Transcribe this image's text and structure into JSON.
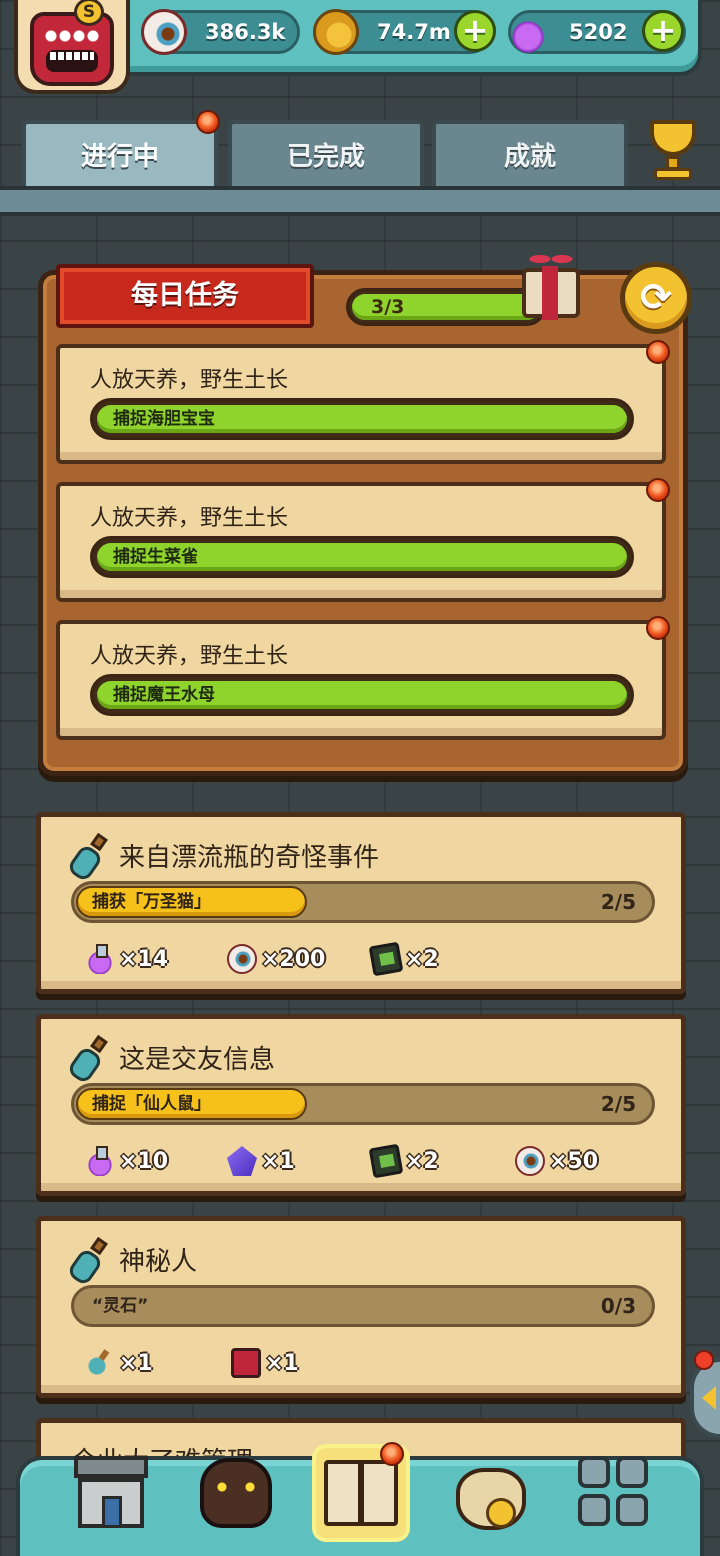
{
  "resources": [
    {
      "icon": "eyeball-icon",
      "value": "386.3k"
    },
    {
      "icon": "coin-icon",
      "value": "74.7m"
    },
    {
      "icon": "potion-icon",
      "value": "5202"
    }
  ],
  "avatar": {
    "badge": "S",
    "icon": "monster-avatar-icon"
  },
  "plus_symbol": "+",
  "tabs": [
    {
      "label": "进行中",
      "active": true,
      "has_dot": true
    },
    {
      "label": "已完成",
      "active": false,
      "has_dot": false
    },
    {
      "label": "成就",
      "active": false,
      "has_dot": false
    }
  ],
  "daily": {
    "title": "每日任务",
    "progress_text": "3/3",
    "progress": 1.0,
    "refresh_symbol": "⟳",
    "quests": [
      {
        "title": "人放天养，野生土长",
        "task": "捕捉海胆宝宝",
        "progress": 1.0
      },
      {
        "title": "人放天养，野生土长",
        "task": "捕捉生菜雀",
        "progress": 1.0
      },
      {
        "title": "人放天养，野生土长",
        "task": "捕捉魔王水母",
        "progress": 1.0
      }
    ]
  },
  "events": [
    {
      "title": "来自漂流瓶的奇怪事件",
      "task": "捕获「万圣猫」",
      "count": "2/5",
      "progress": 0.4,
      "rewards": [
        {
          "icon": "potion-icon",
          "qty": "×14"
        },
        {
          "icon": "eyeball-icon",
          "qty": "×200"
        },
        {
          "icon": "card-icon",
          "qty": "×2"
        }
      ]
    },
    {
      "title": "这是交友信息",
      "task": "捕捉「仙人鼠」",
      "count": "2/5",
      "progress": 0.4,
      "rewards": [
        {
          "icon": "potion-icon",
          "qty": "×10"
        },
        {
          "icon": "crystal-icon",
          "qty": "×1"
        },
        {
          "icon": "card-icon",
          "qty": "×2"
        },
        {
          "icon": "eyeball-icon",
          "qty": "×50"
        }
      ]
    },
    {
      "title": "神秘人",
      "task": "“灵石”",
      "count": "0/3",
      "progress": 0.0,
      "rewards": [
        {
          "icon": "bottle-icon",
          "qty": "×1"
        },
        {
          "icon": "jar-icon",
          "qty": "×1"
        }
      ]
    },
    {
      "title": "企业大了难管理",
      "task": "",
      "count": "",
      "progress": 0.0,
      "rewards": []
    }
  ],
  "bottom_nav": [
    {
      "name": "shop-icon",
      "active": false
    },
    {
      "name": "monster-icon",
      "active": false
    },
    {
      "name": "quest-book-icon",
      "active": true,
      "has_dot": true
    },
    {
      "name": "money-bag-icon",
      "active": false
    },
    {
      "name": "menu-grid-icon",
      "active": false
    }
  ],
  "colors": {
    "teal": "#5fc0c0",
    "green_bar": "#8fd42c",
    "yellow_bar": "#f6c11a",
    "parchment": "#f0d7a2",
    "wood": "#a9652f",
    "red_banner": "#c8291d"
  }
}
